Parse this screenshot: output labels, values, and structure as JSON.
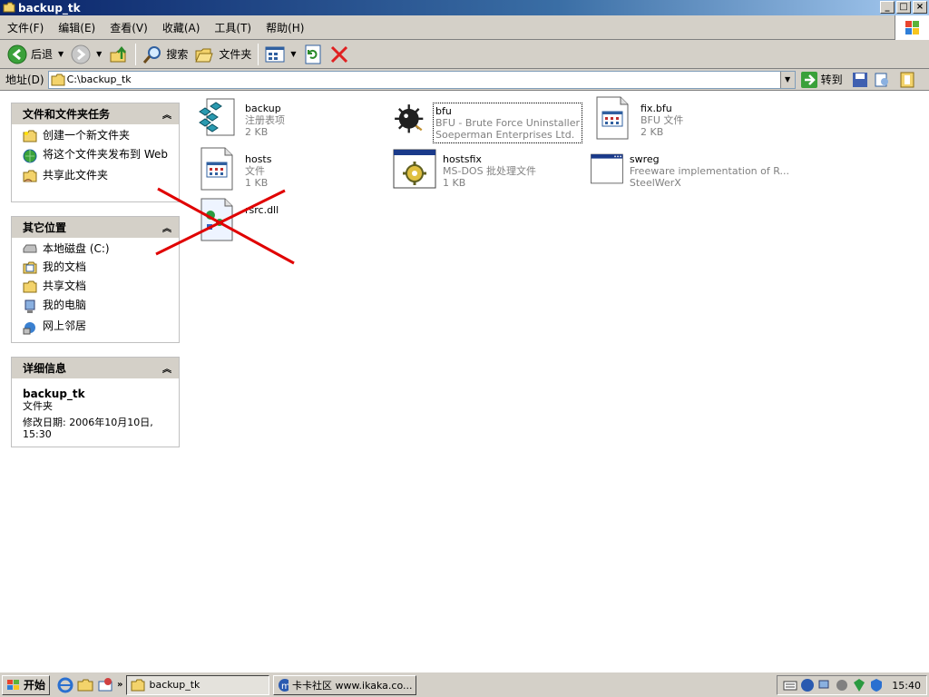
{
  "window": {
    "title": "backup_tk"
  },
  "menubar": {
    "items": [
      "文件(F)",
      "编辑(E)",
      "查看(V)",
      "收藏(A)",
      "工具(T)",
      "帮助(H)"
    ]
  },
  "toolbar": {
    "back": "后退",
    "search": "搜索",
    "folders": "文件夹"
  },
  "address": {
    "label": "地址(D)",
    "value": "C:\\backup_tk",
    "go": "转到"
  },
  "tasks": {
    "title": "文件和文件夹任务",
    "items": [
      "创建一个新文件夹",
      "将这个文件夹发布到 Web",
      "共享此文件夹"
    ]
  },
  "places": {
    "title": "其它位置",
    "items": [
      "本地磁盘 (C:)",
      "我的文档",
      "共享文档",
      "我的电脑",
      "网上邻居"
    ]
  },
  "details": {
    "title": "详细信息",
    "name": "backup_tk",
    "type": "文件夹",
    "modified": "修改日期: 2006年10月10日, 15:30"
  },
  "files": [
    {
      "name": "backup",
      "line1": "注册表项",
      "line2": "2 KB",
      "icon": "registry-icon"
    },
    {
      "name": "bfu",
      "line1": "BFU - Brute Force Uninstaller",
      "line2": "Soeperman Enterprises Ltd.",
      "icon": "bfu-bomb-icon"
    },
    {
      "name": "fix.bfu",
      "line1": "BFU 文件",
      "line2": "2 KB",
      "icon": "document-icon"
    },
    {
      "name": "hosts",
      "line1": "文件",
      "line2": "1 KB",
      "icon": "document-icon"
    },
    {
      "name": "hostsfix",
      "line1": "MS-DOS 批处理文件",
      "line2": "1 KB",
      "icon": "batch-gear-icon"
    },
    {
      "name": "swreg",
      "line1": "Freeware implementation of R...",
      "line2": "SteelWerX",
      "icon": "application-window-icon"
    },
    {
      "name": "rsrc.dll",
      "line1": "",
      "line2": "",
      "icon": "dll-icon"
    }
  ],
  "taskbar": {
    "start": "开始",
    "buttons": [
      "backup_tk",
      "卡卡社区 www.ikaka.co..."
    ],
    "clock": "15:40"
  },
  "colors": {
    "titlebar": "#0a246a",
    "panel_head": "#d4d0c8",
    "annotation_x": "#e00000"
  }
}
